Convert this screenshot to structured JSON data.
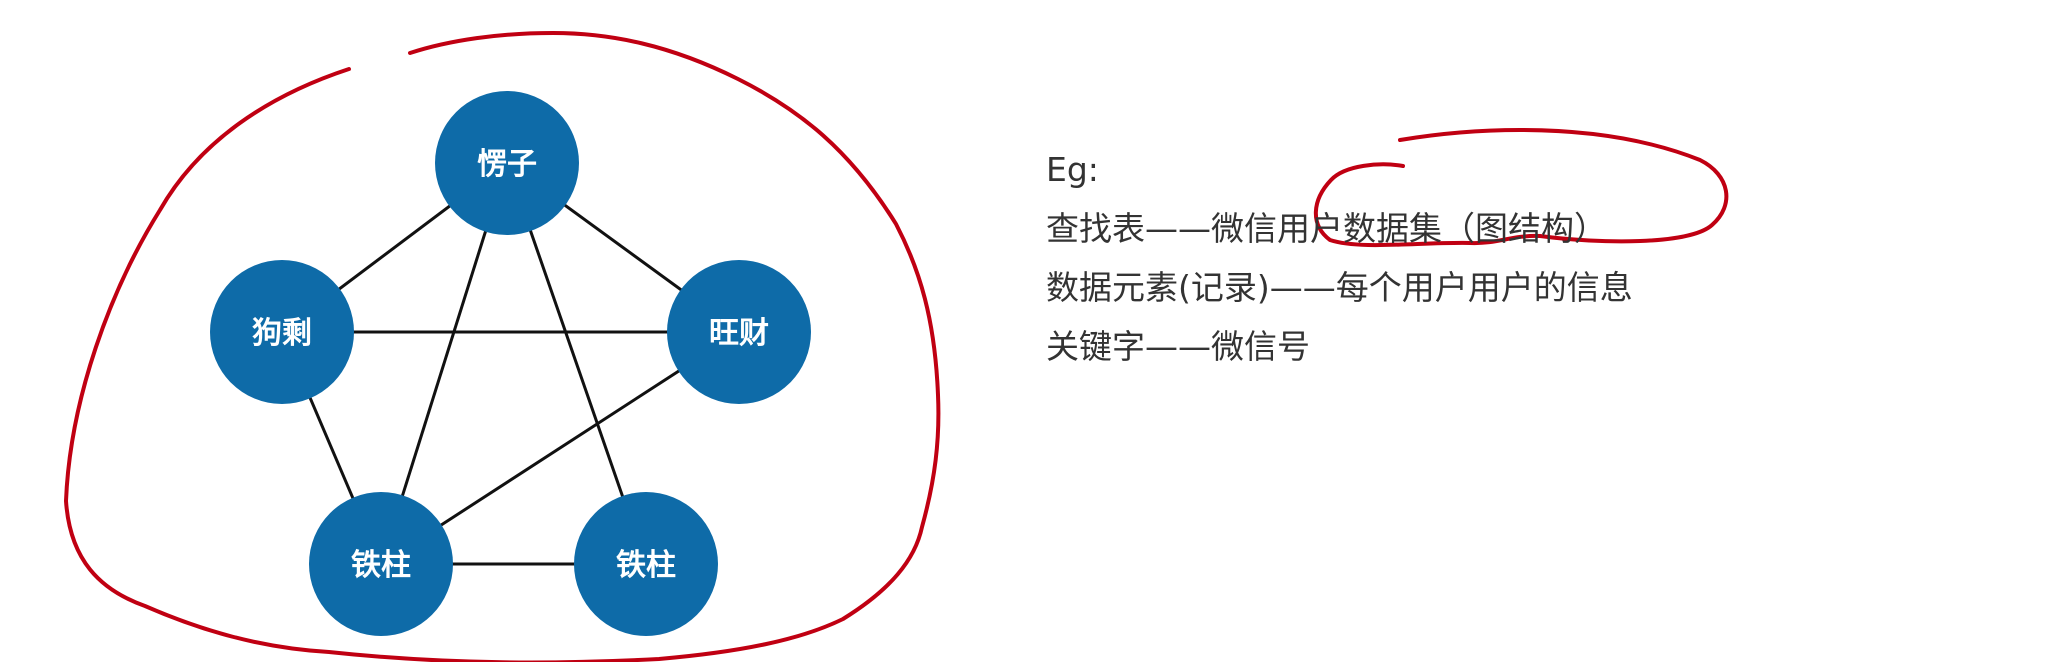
{
  "graph": {
    "node_color": "#0e6ba8",
    "edge_color": "#111111",
    "nodes": [
      {
        "id": "n1",
        "label": "愣子"
      },
      {
        "id": "n2",
        "label": "狗剩"
      },
      {
        "id": "n3",
        "label": "旺财"
      },
      {
        "id": "n4",
        "label": "铁柱"
      },
      {
        "id": "n5",
        "label": "铁柱"
      }
    ],
    "edges": [
      [
        "n1",
        "n2"
      ],
      [
        "n1",
        "n3"
      ],
      [
        "n1",
        "n4"
      ],
      [
        "n1",
        "n5"
      ],
      [
        "n2",
        "n3"
      ],
      [
        "n2",
        "n4"
      ],
      [
        "n3",
        "n4"
      ],
      [
        "n4",
        "n5"
      ]
    ]
  },
  "annotation": {
    "color": "#c00012"
  },
  "notes": {
    "heading": "Eg:",
    "lines": [
      "查找表——微信用户数据集（图结构）",
      "数据元素(记录)——每个用户用户的信息",
      "关键字——微信号"
    ]
  }
}
